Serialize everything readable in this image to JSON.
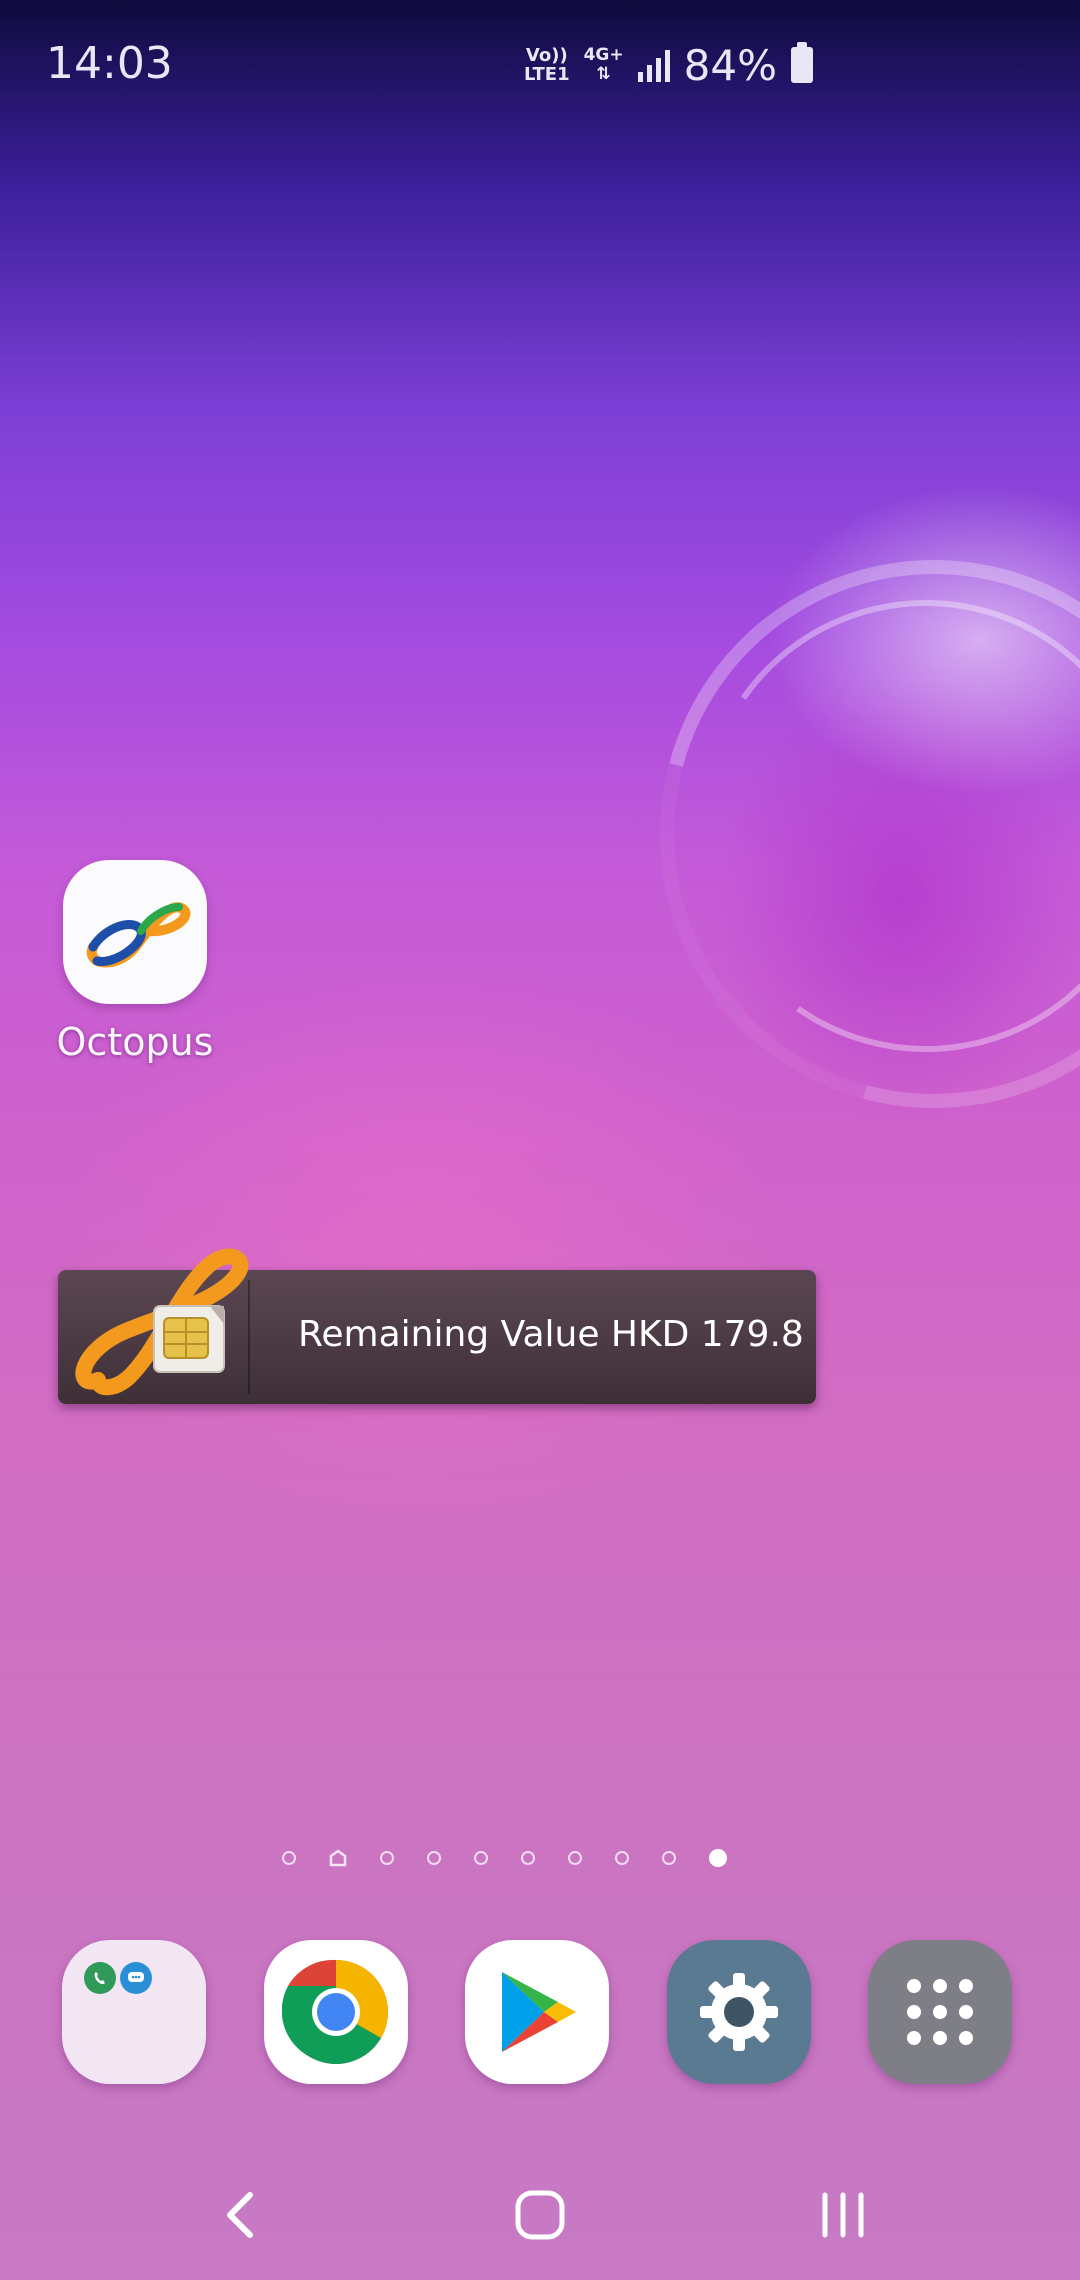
{
  "status_bar": {
    "time": "14:03",
    "volte_top": "Vo))",
    "volte_bottom": "LTE1",
    "network_type": "4G+",
    "battery_percent": "84%",
    "signal_icon": "signal-bars-icon",
    "battery_icon": "battery-icon"
  },
  "home": {
    "apps": [
      {
        "label": "Octopus",
        "icon": "octopus-app-icon"
      }
    ],
    "widget": {
      "icon": "octopus-card-icon",
      "text": "Remaining Value HKD 179.8"
    },
    "page_indicator": {
      "count": 10,
      "home_page_index": 1,
      "active_index": 9
    }
  },
  "dock": {
    "apps": [
      {
        "icon": "phone-messages-folder-icon"
      },
      {
        "icon": "chrome-icon"
      },
      {
        "icon": "play-store-icon"
      },
      {
        "icon": "settings-gear-icon"
      },
      {
        "icon": "apps-grid-icon"
      }
    ]
  },
  "nav_bar": {
    "back_icon": "back-icon",
    "home_icon": "home-icon",
    "recents_icon": "recents-icon"
  },
  "colors": {
    "wallpaper_top": "#0e0b3d",
    "wallpaper_mid": "#c45ad8",
    "wallpaper_bottom": "#c87ac4",
    "octopus_orange": "#f39a1e",
    "octopus_blue": "#1d4fa8",
    "octopus_green": "#2aa84a",
    "widget_bg": "#4a3a43"
  }
}
